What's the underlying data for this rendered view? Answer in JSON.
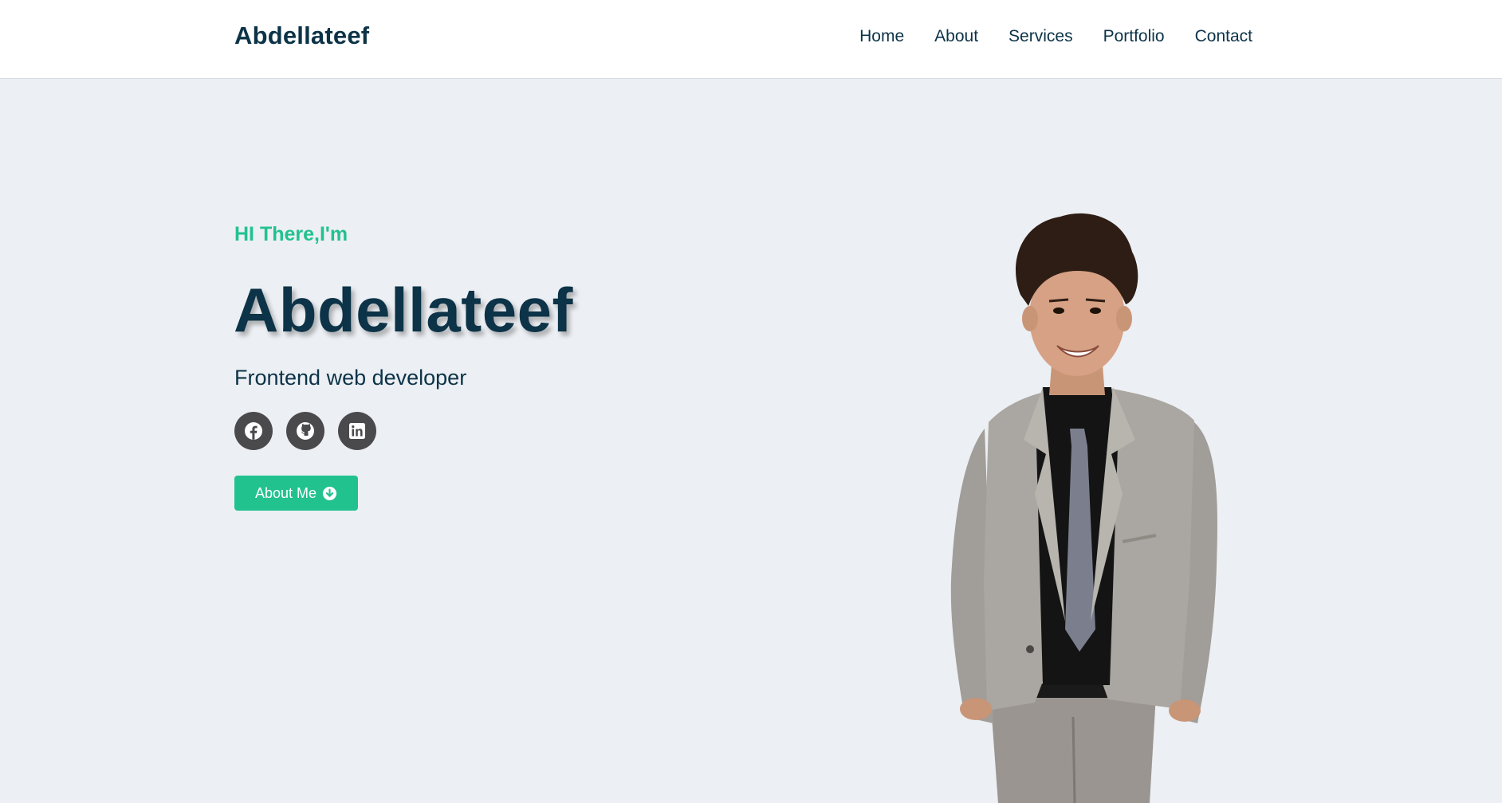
{
  "navbar": {
    "brand": "Abdellateef",
    "links": [
      "Home",
      "About",
      "Services",
      "Portfolio",
      "Contact"
    ]
  },
  "hero": {
    "greeting": "HI There,I'm",
    "name": "Abdellateef",
    "role": "Frontend web developer",
    "socials": [
      "facebook-icon",
      "github-icon",
      "linkedin-icon"
    ],
    "cta_label": "About Me",
    "cta_icon": "arrow-down-circle-icon"
  },
  "colors": {
    "accent": "#22c28f",
    "heading": "#0c3347",
    "background": "#eceff3",
    "social_bg": "#4a4a4d"
  }
}
